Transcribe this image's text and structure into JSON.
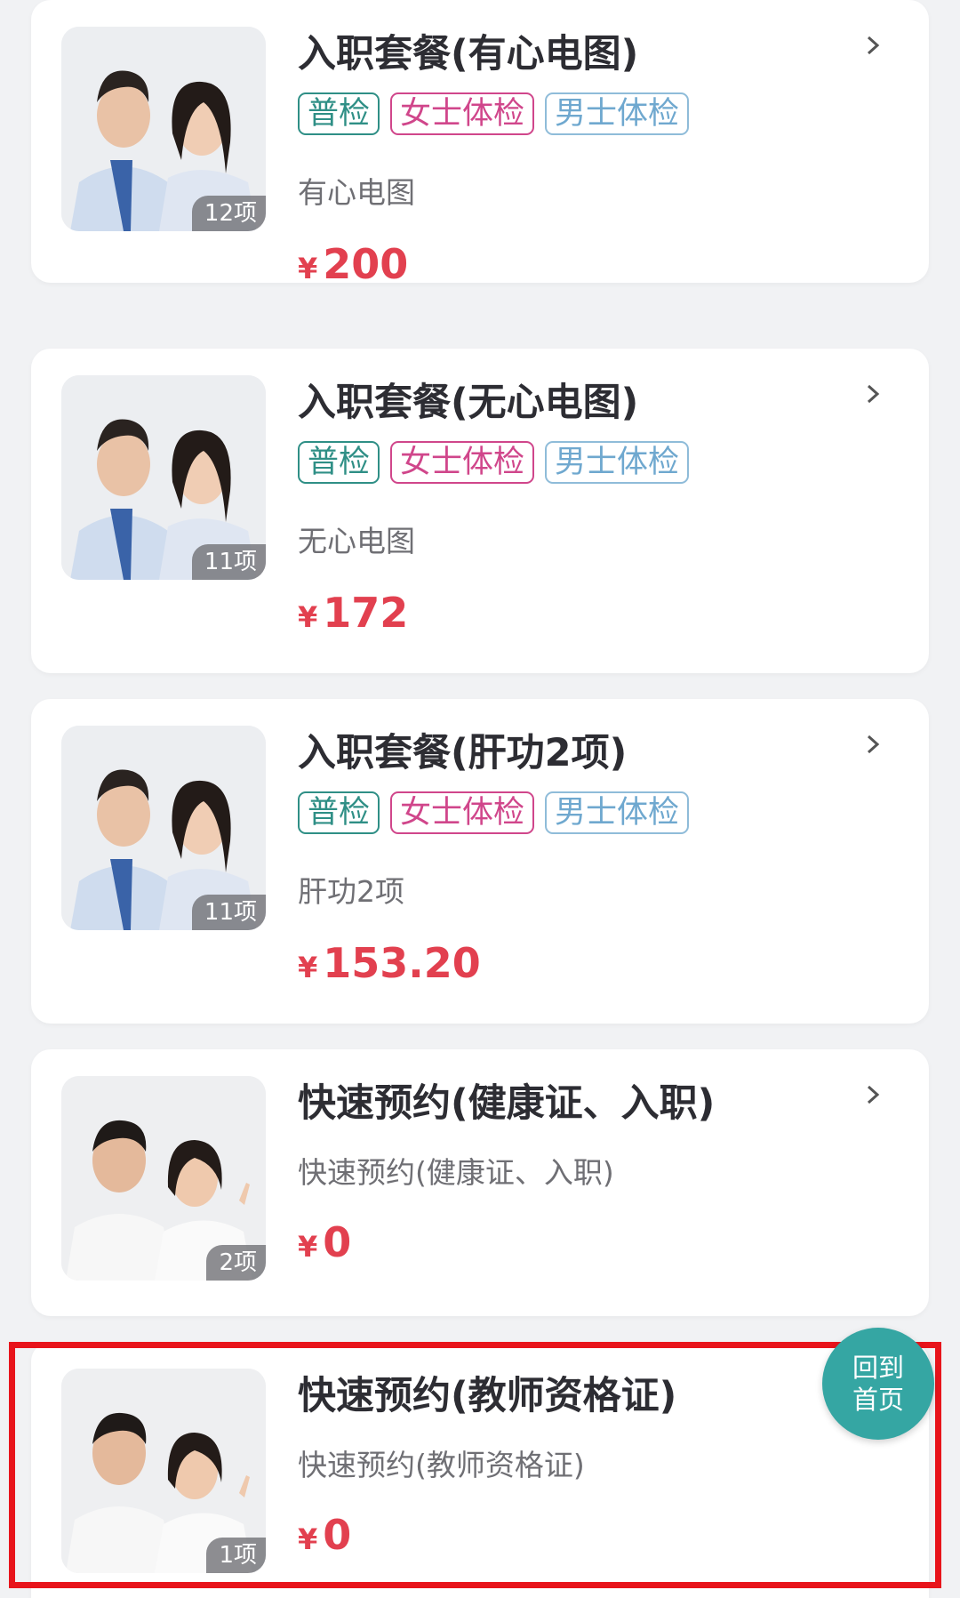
{
  "colors": {
    "price": "#e2404f",
    "tag_general": "#2f8f86",
    "tag_female": "#d0468b",
    "tag_male": "#6fa8cf",
    "home_button": "#35a6a3",
    "highlight_border": "#e8141b"
  },
  "packages": [
    {
      "title": "入职套餐(有心电图)",
      "tags": [
        "普检",
        "女士体检",
        "男士体检"
      ],
      "description": "有心电图",
      "currency": "¥",
      "price": "200",
      "item_count": "12项",
      "image": "couple-business-photo"
    },
    {
      "title": "入职套餐(无心电图)",
      "tags": [
        "普检",
        "女士体检",
        "男士体检"
      ],
      "description": "无心电图",
      "currency": "¥",
      "price": "172",
      "item_count": "11项",
      "image": "couple-business-photo"
    },
    {
      "title": "入职套餐(肝功2项)",
      "tags": [
        "普检",
        "女士体检",
        "男士体检"
      ],
      "description": "肝功2项",
      "currency": "¥",
      "price": "153.20",
      "item_count": "11项",
      "image": "couple-business-photo"
    },
    {
      "title": "快速预约(健康证、入职)",
      "tags": [],
      "description": "快速预约(健康证、入职)",
      "currency": "¥",
      "price": "0",
      "item_count": "2项",
      "image": "couple-white-shirt-photo"
    },
    {
      "title": "快速预约(教师资格证)",
      "tags": [],
      "description": "快速预约(教师资格证)",
      "currency": "¥",
      "price": "0",
      "item_count": "1项",
      "image": "couple-white-shirt-photo"
    }
  ],
  "home_button": {
    "line1": "回到",
    "line2": "首页"
  }
}
